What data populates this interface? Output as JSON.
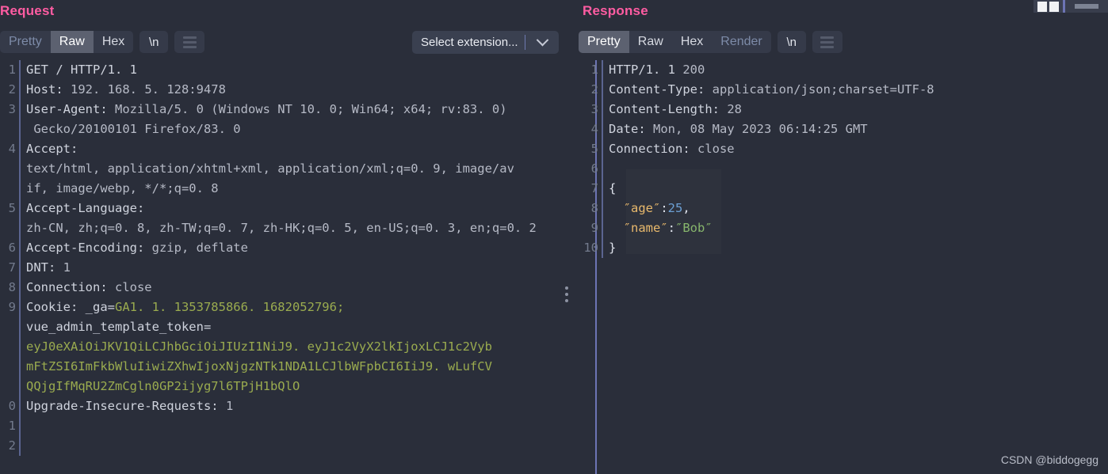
{
  "window": {
    "chrome_icons": [
      "window-square-1",
      "window-square-2",
      "window-divider",
      "window-minimize"
    ]
  },
  "request": {
    "title": "Request",
    "tabs": [
      {
        "label": "Pretty",
        "state": "inactive-dim"
      },
      {
        "label": "Raw",
        "state": "active"
      },
      {
        "label": "Hex",
        "state": "inactive"
      }
    ],
    "newline_button": "\\n",
    "menu_icon": "hamburger-icon",
    "gutter": [
      "1",
      "2",
      "3",
      "",
      "4",
      "",
      "",
      "5",
      "",
      "6",
      "7",
      "8",
      "9",
      "",
      "",
      "",
      "",
      "0",
      "1",
      "2"
    ],
    "lines": [
      {
        "segments": [
          {
            "t": "GET / HTTP/1. 1",
            "c": "c-default"
          }
        ]
      },
      {
        "segments": [
          {
            "t": "Host: ",
            "c": "c-default"
          },
          {
            "t": "192. 168. 5. 128:9478",
            "c": "c-dim"
          }
        ]
      },
      {
        "segments": [
          {
            "t": "User-Agent: ",
            "c": "c-default"
          },
          {
            "t": "Mozilla/5. 0 (Windows NT 10. 0; Win64; x64; rv:83. 0)",
            "c": "c-dim"
          }
        ]
      },
      {
        "segments": [
          {
            "t": " Gecko/20100101 Firefox/83. 0",
            "c": "c-dim"
          }
        ]
      },
      {
        "segments": [
          {
            "t": "Accept:",
            "c": "c-default"
          }
        ]
      },
      {
        "segments": [
          {
            "t": "text/html, application/xhtml+xml, application/xml;q=0. 9, image/av",
            "c": "c-dim"
          }
        ]
      },
      {
        "segments": [
          {
            "t": "if, image/webp, */*;q=0. 8",
            "c": "c-dim"
          }
        ]
      },
      {
        "segments": [
          {
            "t": "Accept-Language:",
            "c": "c-default"
          }
        ]
      },
      {
        "segments": [
          {
            "t": "zh-CN, zh;q=0. 8, zh-TW;q=0. 7, zh-HK;q=0. 5, en-US;q=0. 3, en;q=0. 2",
            "c": "c-dim"
          }
        ]
      },
      {
        "segments": [
          {
            "t": "Accept-Encoding: ",
            "c": "c-default"
          },
          {
            "t": "gzip, deflate",
            "c": "c-dim"
          }
        ]
      },
      {
        "segments": [
          {
            "t": "DNT: ",
            "c": "c-default"
          },
          {
            "t": "1",
            "c": "c-dim"
          }
        ]
      },
      {
        "segments": [
          {
            "t": "Connection: ",
            "c": "c-default"
          },
          {
            "t": "close",
            "c": "c-dim"
          }
        ]
      },
      {
        "segments": [
          {
            "t": "Cookie: _ga=",
            "c": "c-default"
          },
          {
            "t": "GA1. 1. 1353785866. 1682052796;",
            "c": "c-green"
          }
        ]
      },
      {
        "segments": [
          {
            "t": "vue_admin_template_token=",
            "c": "c-default"
          }
        ]
      },
      {
        "segments": [
          {
            "t": "eyJ0eXAiOiJKV1QiLCJhbGciOiJIUzI1NiJ9. eyJ1c2VyX2lkIjoxLCJ1c2Vyb",
            "c": "c-green"
          }
        ]
      },
      {
        "segments": [
          {
            "t": "mFtZSI6ImFkbWluIiwiZXhwIjoxNjgzNTk1NDA1LCJlbWFpbCI6IiJ9. wLufCV",
            "c": "c-green"
          }
        ]
      },
      {
        "segments": [
          {
            "t": "QQjgIfMqRU2ZmCgln0GP2ijyg7l6TPjH1bQlO",
            "c": "c-green"
          }
        ]
      },
      {
        "segments": [
          {
            "t": "Upgrade-Insecure-Requests: ",
            "c": "c-default"
          },
          {
            "t": "1",
            "c": "c-dim"
          }
        ]
      },
      {
        "segments": [
          {
            "t": "",
            "c": "c-default"
          }
        ]
      },
      {
        "segments": [
          {
            "t": "",
            "c": "c-default"
          }
        ]
      }
    ]
  },
  "select_extension": {
    "label": "Select extension...",
    "arrow_icon": "chevron-down-icon"
  },
  "response": {
    "title": "Response",
    "tabs": [
      {
        "label": "Pretty",
        "state": "active"
      },
      {
        "label": "Raw",
        "state": "inactive"
      },
      {
        "label": "Hex",
        "state": "inactive"
      },
      {
        "label": "Render",
        "state": "inactive-dim"
      }
    ],
    "newline_button": "\\n",
    "menu_icon": "hamburger-icon",
    "gutter": [
      "1",
      "2",
      "3",
      "4",
      "5",
      "6",
      "7",
      "8",
      "9",
      "10"
    ],
    "lines": [
      {
        "segments": [
          {
            "t": "HTTP/1. 1 ",
            "c": "c-default"
          },
          {
            "t": "200",
            "c": "c-dim"
          }
        ]
      },
      {
        "segments": [
          {
            "t": "Content-Type: ",
            "c": "c-default"
          },
          {
            "t": "application/json;charset=UTF-8",
            "c": "c-dim"
          }
        ]
      },
      {
        "segments": [
          {
            "t": "Content-Length: ",
            "c": "c-default"
          },
          {
            "t": "28",
            "c": "c-dim"
          }
        ]
      },
      {
        "segments": [
          {
            "t": "Date: ",
            "c": "c-default"
          },
          {
            "t": "Mon, 08 May 2023 06:14:25 GMT",
            "c": "c-dim"
          }
        ]
      },
      {
        "segments": [
          {
            "t": "Connection: ",
            "c": "c-default"
          },
          {
            "t": "close",
            "c": "c-dim"
          }
        ]
      },
      {
        "segments": [
          {
            "t": "",
            "c": "c-default"
          }
        ]
      },
      {
        "segments": [
          {
            "t": "{",
            "c": "c-white"
          }
        ]
      },
      {
        "segments": [
          {
            "t": "  ″age″",
            "c": "c-jkey"
          },
          {
            "t": ":",
            "c": "c-white"
          },
          {
            "t": "25",
            "c": "c-jnum"
          },
          {
            "t": ",",
            "c": "c-white"
          }
        ]
      },
      {
        "segments": [
          {
            "t": "  ″name″",
            "c": "c-jkey"
          },
          {
            "t": ":",
            "c": "c-white"
          },
          {
            "t": "″Bob″",
            "c": "c-jstr"
          }
        ]
      },
      {
        "segments": [
          {
            "t": "}",
            "c": "c-white"
          }
        ]
      }
    ]
  },
  "kebab_menu": {
    "icon": "vertical-dots-icon"
  },
  "watermark": {
    "text": "CSDN @biddogegg"
  },
  "colors": {
    "background": "#2a2e3a",
    "panel_title": "#ff5ca2",
    "splitter": "#6c74b4",
    "tab_active_bg": "#5c6170",
    "token_green": "#9aab4f",
    "json_key": "#e8b86a",
    "json_number": "#6a9fd4",
    "json_string": "#85b56a"
  }
}
